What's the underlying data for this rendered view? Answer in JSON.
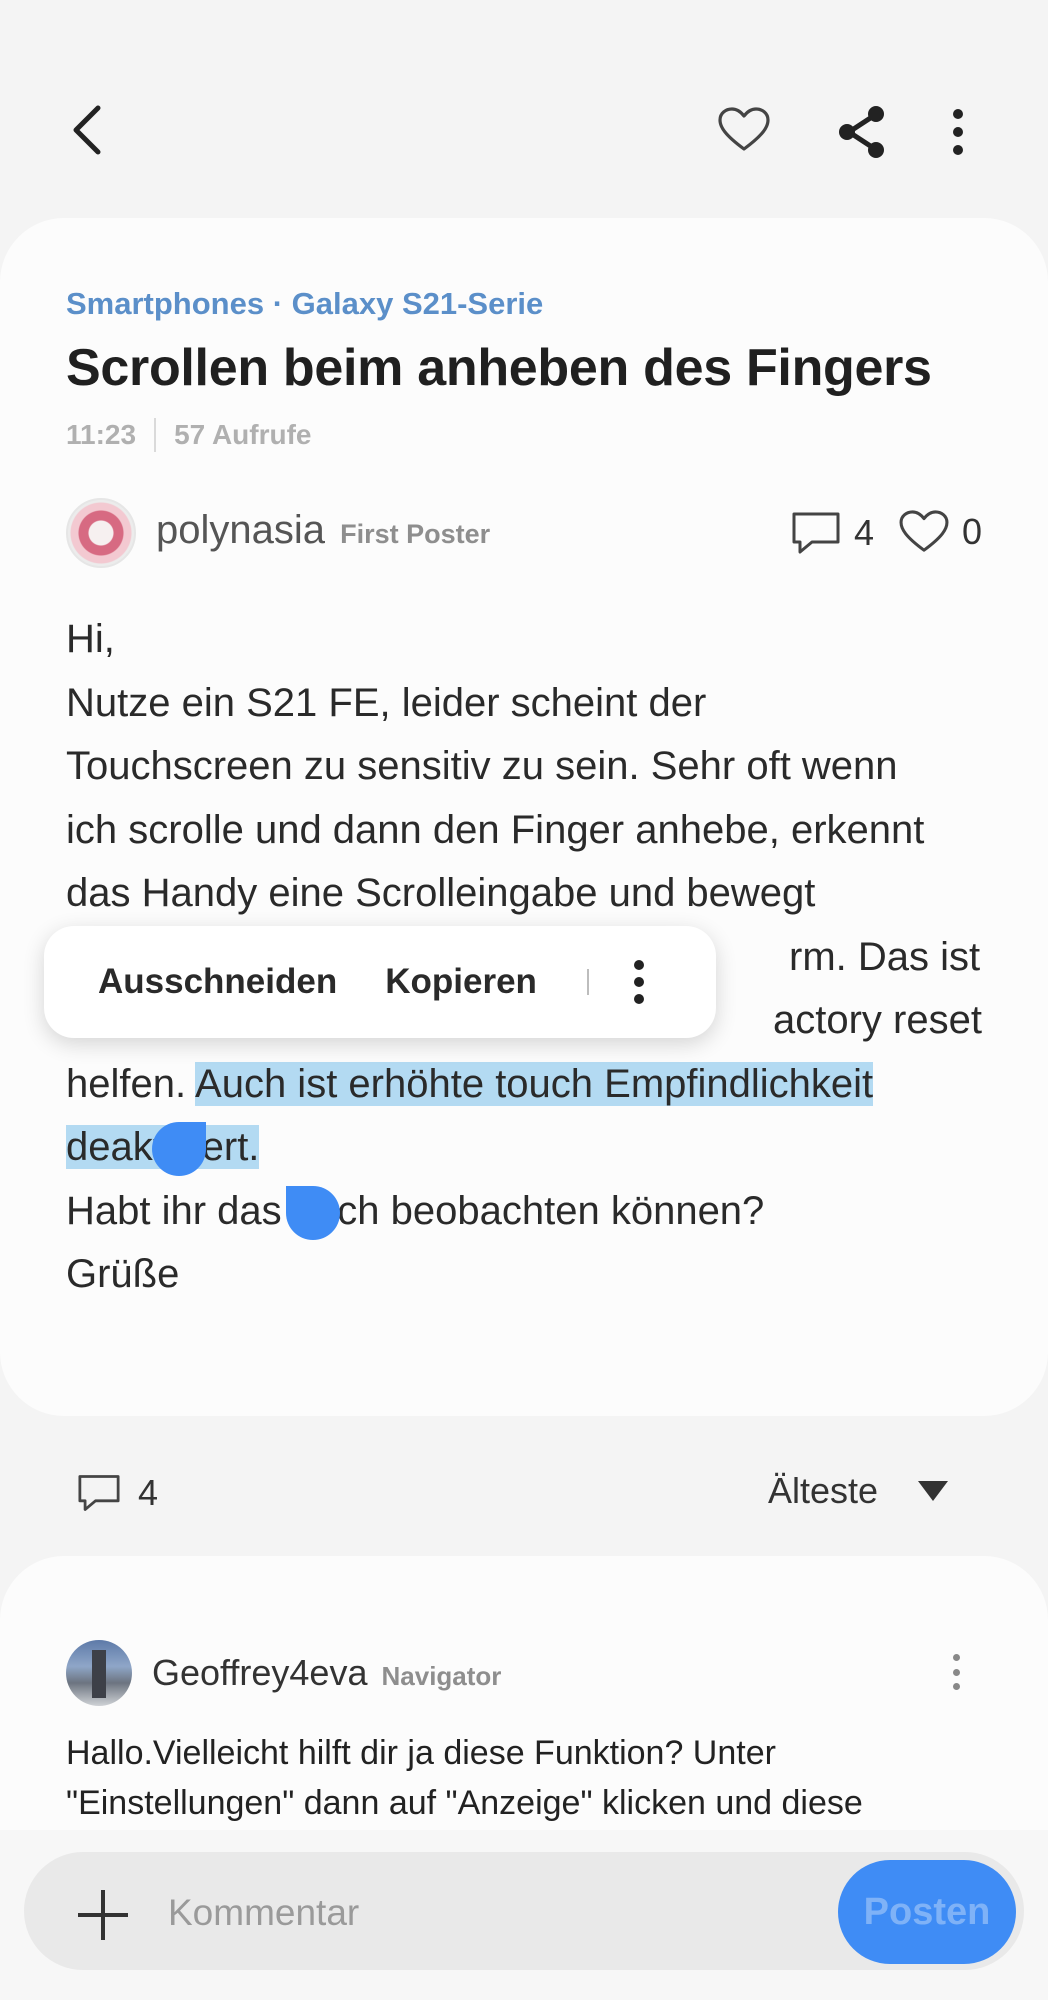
{
  "header": {
    "back_icon": "chevron-left-icon",
    "like_icon": "heart-outline-icon",
    "share_icon": "share-icon",
    "more_icon": "more-vertical-icon"
  },
  "post": {
    "breadcrumb": "Smartphones · Galaxy S21-Serie",
    "title": "Scrollen beim anheben des Fingers",
    "time": "11:23",
    "views": "57 Aufrufe",
    "author": {
      "name": "polynasia",
      "badge": "First Poster"
    },
    "comment_count": "4",
    "like_count": "0",
    "body": {
      "l1": "Hi,",
      "l2": "Nutze ein S21 FE, leider scheint der",
      "l3": "Touchscreen zu sensitiv zu sein. Sehr oft wenn",
      "l4": "ich scrolle und dann den Finger anhebe, erkennt",
      "l5": "das Handy eine Scrolleingabe und bewegt",
      "l6_visible": "rm. Das ist",
      "l7_visible": "actory reset",
      "l8_plain": "helfen. ",
      "l8_selected": "Auch ist erhöhte touch Empfindlichkeit",
      "l9_selected": "deaktiviert.",
      "l10": "Habt ihr das auch beobachten können?",
      "l11": "Grüße"
    }
  },
  "context_menu": {
    "cut": "Ausschneiden",
    "copy": "Kopieren"
  },
  "comments_bar": {
    "count": "4",
    "sort_label": "Älteste"
  },
  "comment": {
    "author": "Geoffrey4eva",
    "badge": "Navigator",
    "line1": "Hallo.Vielleicht hilft dir ja diese Funktion? Unter",
    "line2": "\"Einstellungen\" dann auf \"Anzeige\" klicken und diese"
  },
  "composer": {
    "placeholder": "Kommentar",
    "post_label": "Posten"
  },
  "colors": {
    "accent": "#3f8cf5",
    "breadcrumb": "#5b8fc9",
    "selection": "#b3daf2"
  }
}
